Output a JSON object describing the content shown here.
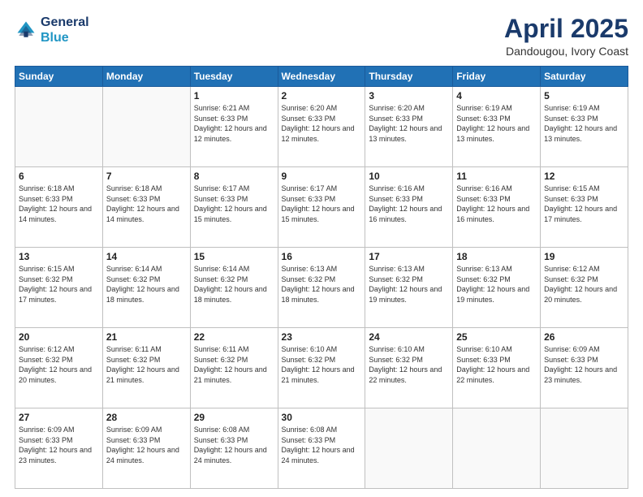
{
  "header": {
    "logo_line1": "General",
    "logo_line2": "Blue",
    "title": "April 2025",
    "subtitle": "Dandougou, Ivory Coast"
  },
  "columns": [
    "Sunday",
    "Monday",
    "Tuesday",
    "Wednesday",
    "Thursday",
    "Friday",
    "Saturday"
  ],
  "weeks": [
    [
      {
        "day": "",
        "info": ""
      },
      {
        "day": "",
        "info": ""
      },
      {
        "day": "1",
        "info": "Sunrise: 6:21 AM\nSunset: 6:33 PM\nDaylight: 12 hours and 12 minutes."
      },
      {
        "day": "2",
        "info": "Sunrise: 6:20 AM\nSunset: 6:33 PM\nDaylight: 12 hours and 12 minutes."
      },
      {
        "day": "3",
        "info": "Sunrise: 6:20 AM\nSunset: 6:33 PM\nDaylight: 12 hours and 13 minutes."
      },
      {
        "day": "4",
        "info": "Sunrise: 6:19 AM\nSunset: 6:33 PM\nDaylight: 12 hours and 13 minutes."
      },
      {
        "day": "5",
        "info": "Sunrise: 6:19 AM\nSunset: 6:33 PM\nDaylight: 12 hours and 13 minutes."
      }
    ],
    [
      {
        "day": "6",
        "info": "Sunrise: 6:18 AM\nSunset: 6:33 PM\nDaylight: 12 hours and 14 minutes."
      },
      {
        "day": "7",
        "info": "Sunrise: 6:18 AM\nSunset: 6:33 PM\nDaylight: 12 hours and 14 minutes."
      },
      {
        "day": "8",
        "info": "Sunrise: 6:17 AM\nSunset: 6:33 PM\nDaylight: 12 hours and 15 minutes."
      },
      {
        "day": "9",
        "info": "Sunrise: 6:17 AM\nSunset: 6:33 PM\nDaylight: 12 hours and 15 minutes."
      },
      {
        "day": "10",
        "info": "Sunrise: 6:16 AM\nSunset: 6:33 PM\nDaylight: 12 hours and 16 minutes."
      },
      {
        "day": "11",
        "info": "Sunrise: 6:16 AM\nSunset: 6:33 PM\nDaylight: 12 hours and 16 minutes."
      },
      {
        "day": "12",
        "info": "Sunrise: 6:15 AM\nSunset: 6:33 PM\nDaylight: 12 hours and 17 minutes."
      }
    ],
    [
      {
        "day": "13",
        "info": "Sunrise: 6:15 AM\nSunset: 6:32 PM\nDaylight: 12 hours and 17 minutes."
      },
      {
        "day": "14",
        "info": "Sunrise: 6:14 AM\nSunset: 6:32 PM\nDaylight: 12 hours and 18 minutes."
      },
      {
        "day": "15",
        "info": "Sunrise: 6:14 AM\nSunset: 6:32 PM\nDaylight: 12 hours and 18 minutes."
      },
      {
        "day": "16",
        "info": "Sunrise: 6:13 AM\nSunset: 6:32 PM\nDaylight: 12 hours and 18 minutes."
      },
      {
        "day": "17",
        "info": "Sunrise: 6:13 AM\nSunset: 6:32 PM\nDaylight: 12 hours and 19 minutes."
      },
      {
        "day": "18",
        "info": "Sunrise: 6:13 AM\nSunset: 6:32 PM\nDaylight: 12 hours and 19 minutes."
      },
      {
        "day": "19",
        "info": "Sunrise: 6:12 AM\nSunset: 6:32 PM\nDaylight: 12 hours and 20 minutes."
      }
    ],
    [
      {
        "day": "20",
        "info": "Sunrise: 6:12 AM\nSunset: 6:32 PM\nDaylight: 12 hours and 20 minutes."
      },
      {
        "day": "21",
        "info": "Sunrise: 6:11 AM\nSunset: 6:32 PM\nDaylight: 12 hours and 21 minutes."
      },
      {
        "day": "22",
        "info": "Sunrise: 6:11 AM\nSunset: 6:32 PM\nDaylight: 12 hours and 21 minutes."
      },
      {
        "day": "23",
        "info": "Sunrise: 6:10 AM\nSunset: 6:32 PM\nDaylight: 12 hours and 21 minutes."
      },
      {
        "day": "24",
        "info": "Sunrise: 6:10 AM\nSunset: 6:32 PM\nDaylight: 12 hours and 22 minutes."
      },
      {
        "day": "25",
        "info": "Sunrise: 6:10 AM\nSunset: 6:33 PM\nDaylight: 12 hours and 22 minutes."
      },
      {
        "day": "26",
        "info": "Sunrise: 6:09 AM\nSunset: 6:33 PM\nDaylight: 12 hours and 23 minutes."
      }
    ],
    [
      {
        "day": "27",
        "info": "Sunrise: 6:09 AM\nSunset: 6:33 PM\nDaylight: 12 hours and 23 minutes."
      },
      {
        "day": "28",
        "info": "Sunrise: 6:09 AM\nSunset: 6:33 PM\nDaylight: 12 hours and 24 minutes."
      },
      {
        "day": "29",
        "info": "Sunrise: 6:08 AM\nSunset: 6:33 PM\nDaylight: 12 hours and 24 minutes."
      },
      {
        "day": "30",
        "info": "Sunrise: 6:08 AM\nSunset: 6:33 PM\nDaylight: 12 hours and 24 minutes."
      },
      {
        "day": "",
        "info": ""
      },
      {
        "day": "",
        "info": ""
      },
      {
        "day": "",
        "info": ""
      }
    ]
  ]
}
